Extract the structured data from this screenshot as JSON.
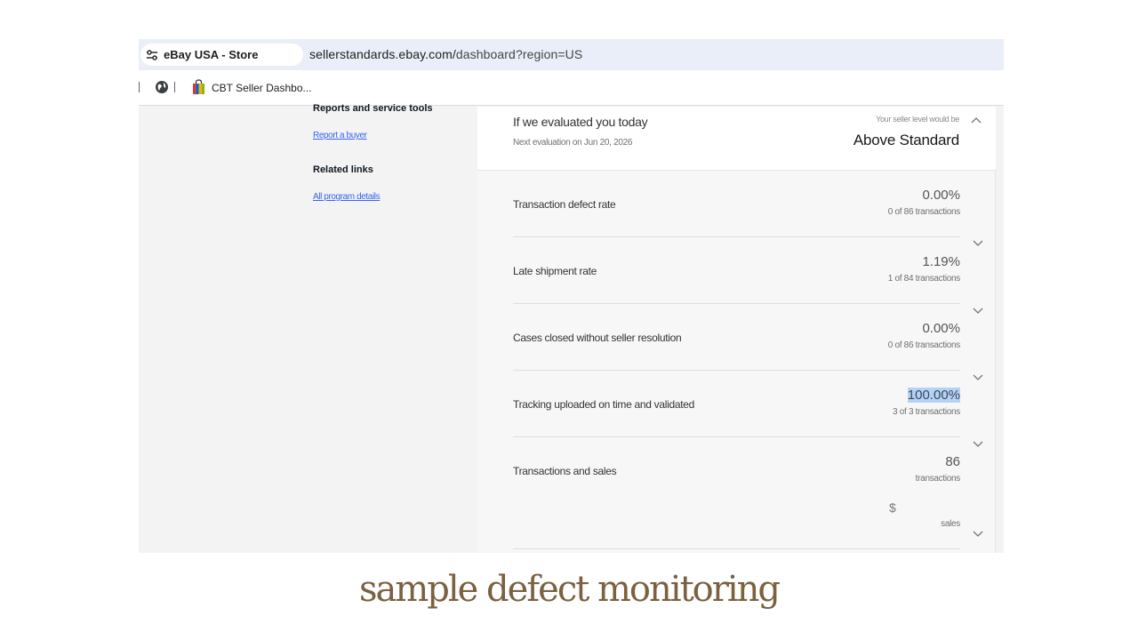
{
  "browser": {
    "tab_title": "eBay USA - Store",
    "url_host": "sellerstandards.ebay.com/",
    "url_path": "dashboard?region=US",
    "bookmark_label": "CBT Seller Dashbo...",
    "icons": {
      "tab": "tune-icon",
      "globe": "globe-icon",
      "bookmark": "shopping-bag-icon"
    }
  },
  "sidebar": {
    "reports_heading": "Reports and service tools",
    "report_link": "Report a buyer",
    "related_heading": "Related links",
    "program_link": "All program details",
    "link_color": "#3665f3"
  },
  "evaluation": {
    "title": "If we evaluated you today",
    "next_eval": "Next evaluation on Jun 20, 2026",
    "level_caption": "Your seller level would be",
    "level_value": "Above Standard"
  },
  "metrics": [
    {
      "label": "Transaction defect rate",
      "value": "0.00%",
      "sub": "0 of 86 transactions"
    },
    {
      "label": "Late shipment rate",
      "value": "1.19%",
      "sub": "1 of 84 transactions"
    },
    {
      "label": "Cases closed without seller resolution",
      "value": "0.00%",
      "sub": "0 of 86 transactions"
    },
    {
      "label": "Tracking uploaded on time and validated",
      "value": "100.00%",
      "sub": "3 of 3 transactions",
      "highlighted": true
    },
    {
      "label": "Transactions and sales",
      "value": "86",
      "sub": "transactions",
      "sales_symbol": "$",
      "sales_sub": "sales"
    }
  ],
  "caption": "sample defect monitoring",
  "colors": {
    "highlight": "#b4d2f5",
    "caption": "#7a6140",
    "address_bar": "#e9eef8"
  }
}
